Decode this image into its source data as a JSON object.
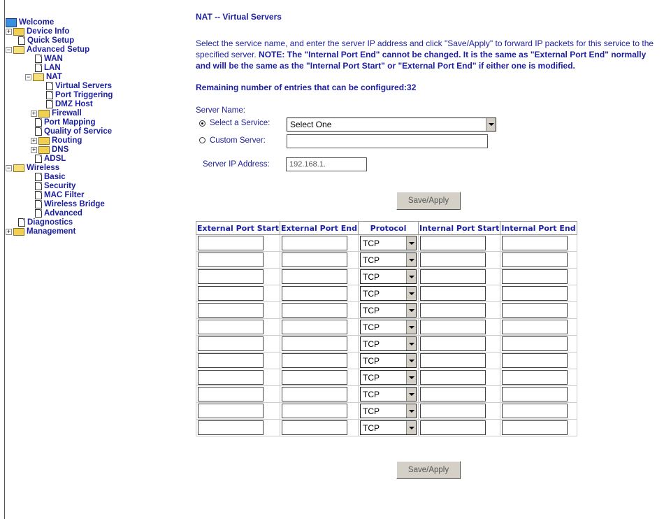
{
  "sidebar": {
    "items": [
      {
        "label": "Welcome",
        "icon": "globe-icon"
      },
      {
        "label": "Device Info",
        "icon": "folder-icon"
      },
      {
        "label": "Quick Setup",
        "icon": "document-icon"
      },
      {
        "label": "Advanced Setup",
        "icon": "open-folder-icon"
      },
      {
        "label": "WAN",
        "icon": "document-icon"
      },
      {
        "label": "LAN",
        "icon": "document-icon"
      },
      {
        "label": "NAT",
        "icon": "open-folder-icon"
      },
      {
        "label": "Virtual Servers",
        "icon": "document-icon"
      },
      {
        "label": "Port Triggering",
        "icon": "document-icon"
      },
      {
        "label": "DMZ Host",
        "icon": "document-icon"
      },
      {
        "label": "Firewall",
        "icon": "folder-icon"
      },
      {
        "label": "Port Mapping",
        "icon": "document-icon"
      },
      {
        "label": "Quality of Service",
        "icon": "document-icon"
      },
      {
        "label": "Routing",
        "icon": "folder-icon"
      },
      {
        "label": "DNS",
        "icon": "folder-icon"
      },
      {
        "label": "ADSL",
        "icon": "document-icon"
      },
      {
        "label": "Wireless",
        "icon": "open-folder-icon"
      },
      {
        "label": "Basic",
        "icon": "document-icon"
      },
      {
        "label": "Security",
        "icon": "document-icon"
      },
      {
        "label": "MAC Filter",
        "icon": "document-icon"
      },
      {
        "label": "Wireless Bridge",
        "icon": "document-icon"
      },
      {
        "label": "Advanced",
        "icon": "document-icon"
      },
      {
        "label": "Diagnostics",
        "icon": "document-icon"
      },
      {
        "label": "Management",
        "icon": "folder-icon"
      }
    ]
  },
  "page": {
    "title": "NAT -- Virtual Servers",
    "intro_part1": "Select the service name, and enter the server IP address and click \"Save/Apply\" to forward IP packets for this service to the specified server. ",
    "intro_note": "NOTE: The \"Internal Port End\" cannot be changed. It is the same as \"External Port End\" normally and will be the same as the \"Internal Port Start\" or \"External Port End\" if either one is modified.",
    "remaining": "Remaining number of entries that can be configured:32"
  },
  "form": {
    "server_name_label": "Server Name:",
    "select_service_label": "Select a Service:",
    "select_service_value": "Select One",
    "custom_server_label": "Custom Server:",
    "custom_server_value": "",
    "server_ip_label": "Server IP Address:",
    "server_ip_value": "192.168.1.",
    "save_label": "Save/Apply",
    "save_label_bottom": "Save/Apply"
  },
  "table": {
    "headers": [
      "External Port Start",
      "External Port End",
      "Protocol",
      "Internal Port Start",
      "Internal Port End"
    ],
    "protocol_value": "TCP",
    "row_count": 12
  }
}
